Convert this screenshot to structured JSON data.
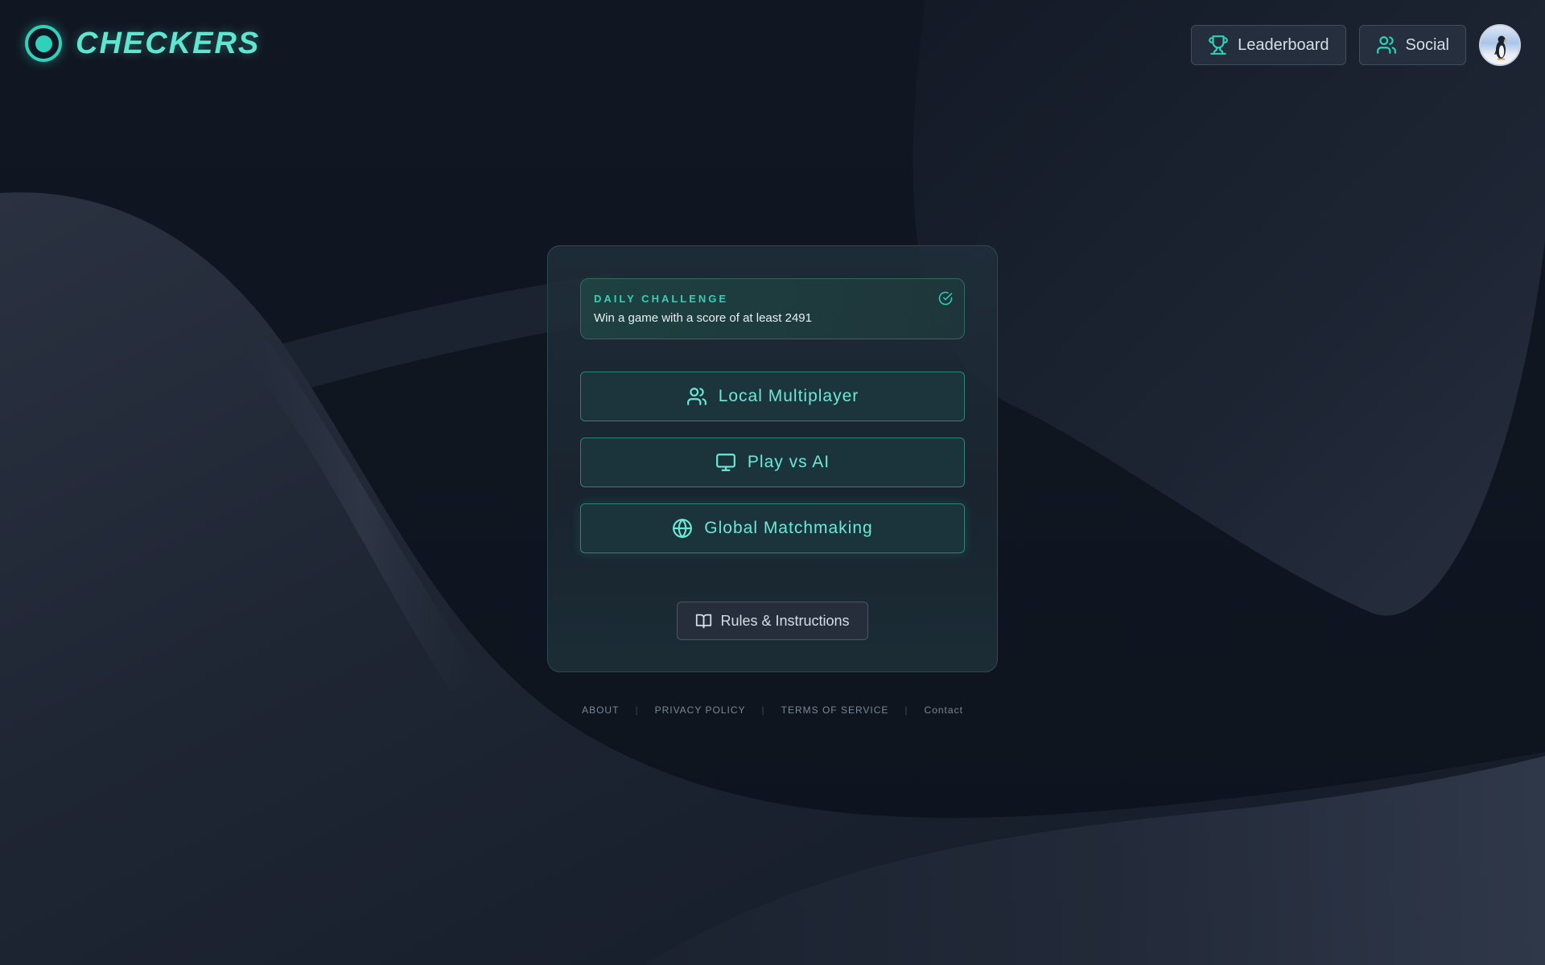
{
  "app": {
    "logo_text": "CHECKERS",
    "accent_color": "#2fd1bb"
  },
  "header": {
    "leaderboard_label": "Leaderboard",
    "leaderboard_icon": "trophy-icon",
    "social_label": "Social",
    "social_icon": "users-icon",
    "avatar_alt": "penguin avatar"
  },
  "daily_challenge": {
    "title": "DAILY CHALLENGE",
    "description": "Win a game with a score of at least 2491",
    "status_icon": "check-circle-icon"
  },
  "modes": [
    {
      "label": "Local Multiplayer",
      "icon": "users-icon"
    },
    {
      "label": "Play vs AI",
      "icon": "monitor-icon"
    },
    {
      "label": "Global Matchmaking",
      "icon": "globe-icon"
    }
  ],
  "rules": {
    "label": "Rules & Instructions",
    "icon": "book-open-icon"
  },
  "footer": {
    "links": [
      "ABOUT",
      "PRIVACY POLICY",
      "TERMS OF SERVICE",
      "Contact"
    ]
  }
}
